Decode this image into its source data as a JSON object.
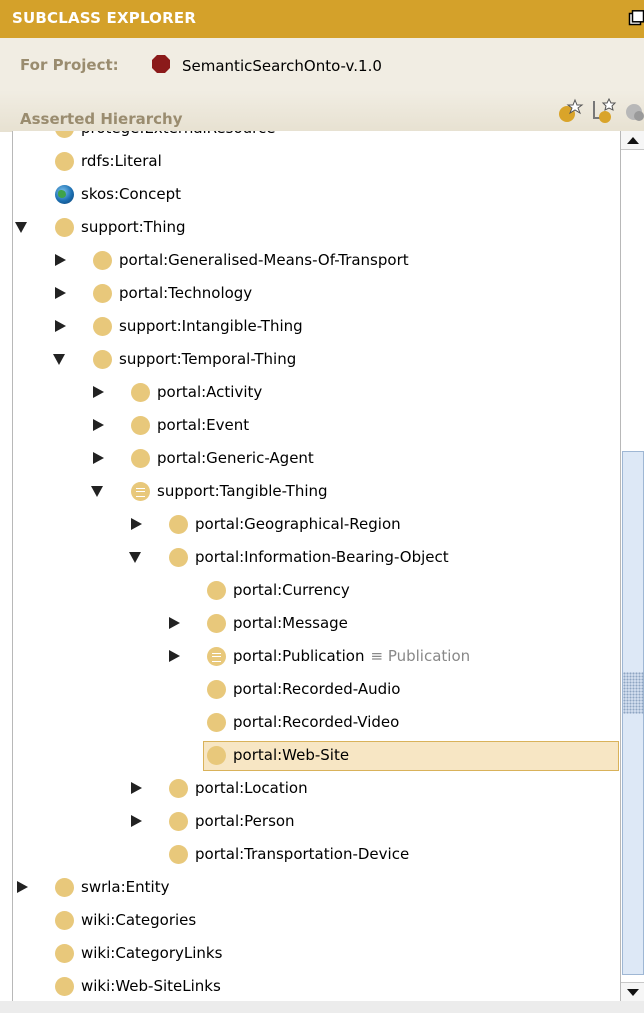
{
  "panel": {
    "title": "SUBCLASS EXPLORER",
    "project_label": "For Project:",
    "project_name": "SemanticSearchOnto-v.1.0",
    "hierarchy_label": "Asserted Hierarchy"
  },
  "colors": {
    "title_bar": "#d4a12a",
    "class_node": "#e8c87b",
    "selection": "#f7e6c4",
    "project_icon": "#8b1a1a"
  },
  "toolbar": {
    "create_subclass_icon": "create-subclass-icon",
    "create_sibling_icon": "create-sibling-class-icon",
    "delete_icon": "delete-class-icon"
  },
  "tree": [
    {
      "label": "protege:ExternalResource",
      "depth": 1,
      "toggle": "none",
      "icon": "class"
    },
    {
      "label": "rdfs:Literal",
      "depth": 1,
      "toggle": "none",
      "icon": "class"
    },
    {
      "label": "skos:Concept",
      "depth": 1,
      "toggle": "none",
      "icon": "globe"
    },
    {
      "label": "support:Thing",
      "depth": 1,
      "toggle": "expanded",
      "icon": "class"
    },
    {
      "label": "portal:Generalised-Means-Of-Transport",
      "depth": 2,
      "toggle": "collapsed",
      "icon": "class"
    },
    {
      "label": "portal:Technology",
      "depth": 2,
      "toggle": "collapsed",
      "icon": "class"
    },
    {
      "label": "support:Intangible-Thing",
      "depth": 2,
      "toggle": "collapsed",
      "icon": "class"
    },
    {
      "label": "support:Temporal-Thing",
      "depth": 2,
      "toggle": "expanded",
      "icon": "class"
    },
    {
      "label": "portal:Activity",
      "depth": 3,
      "toggle": "collapsed",
      "icon": "class"
    },
    {
      "label": "portal:Event",
      "depth": 3,
      "toggle": "collapsed",
      "icon": "class"
    },
    {
      "label": "portal:Generic-Agent",
      "depth": 3,
      "toggle": "collapsed",
      "icon": "class"
    },
    {
      "label": "support:Tangible-Thing",
      "depth": 3,
      "toggle": "expanded",
      "icon": "defined"
    },
    {
      "label": "portal:Geographical-Region",
      "depth": 4,
      "toggle": "collapsed",
      "icon": "class"
    },
    {
      "label": "portal:Information-Bearing-Object",
      "depth": 4,
      "toggle": "expanded",
      "icon": "class"
    },
    {
      "label": "portal:Currency",
      "depth": 5,
      "toggle": "none",
      "icon": "class"
    },
    {
      "label": "portal:Message",
      "depth": 5,
      "toggle": "collapsed",
      "icon": "class"
    },
    {
      "label": "portal:Publication",
      "depth": 5,
      "toggle": "collapsed",
      "icon": "defined",
      "equivalent": "≡ Publication"
    },
    {
      "label": "portal:Recorded-Audio",
      "depth": 5,
      "toggle": "none",
      "icon": "class"
    },
    {
      "label": "portal:Recorded-Video",
      "depth": 5,
      "toggle": "none",
      "icon": "class"
    },
    {
      "label": "portal:Web-Site",
      "depth": 5,
      "toggle": "none",
      "icon": "class",
      "selected": true
    },
    {
      "label": "portal:Location",
      "depth": 4,
      "toggle": "collapsed",
      "icon": "class"
    },
    {
      "label": "portal:Person",
      "depth": 4,
      "toggle": "collapsed",
      "icon": "class"
    },
    {
      "label": "portal:Transportation-Device",
      "depth": 4,
      "toggle": "none",
      "icon": "class"
    },
    {
      "label": "swrla:Entity",
      "depth": 1,
      "toggle": "collapsed",
      "icon": "class"
    },
    {
      "label": "wiki:Categories",
      "depth": 1,
      "toggle": "none",
      "icon": "class"
    },
    {
      "label": "wiki:CategoryLinks",
      "depth": 1,
      "toggle": "none",
      "icon": "class"
    },
    {
      "label": "wiki:Web-SiteLinks",
      "depth": 1,
      "toggle": "none",
      "icon": "class"
    }
  ]
}
